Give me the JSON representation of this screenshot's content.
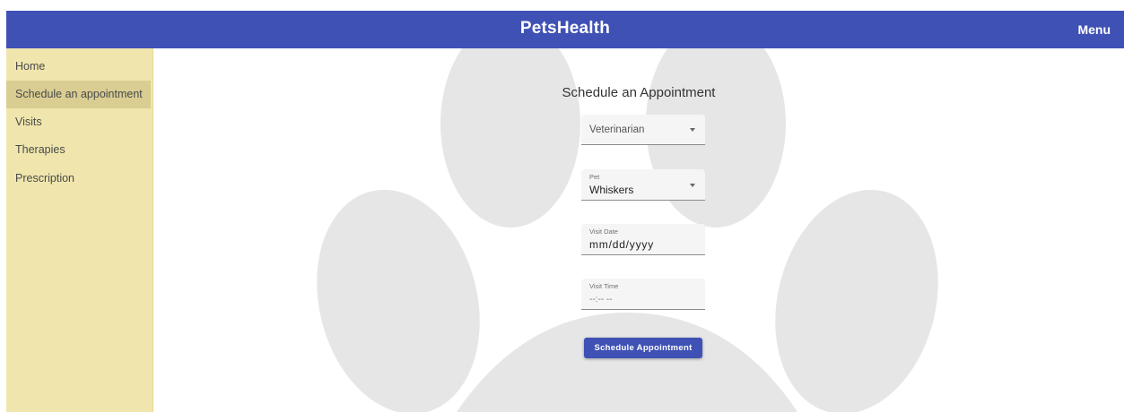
{
  "app": {
    "title": "PetsHealth",
    "menu_label": "Menu",
    "colors": {
      "header": "#3f51b5",
      "sidebar": "#f0e6ad",
      "sidebar_active": "#d9cd92",
      "paw": "#e6e6e6"
    }
  },
  "sidebar": {
    "items": [
      {
        "label": "Home"
      },
      {
        "label": "Schedule an appointment",
        "active": true
      },
      {
        "label": "Visits"
      },
      {
        "label": "Therapies"
      },
      {
        "label": "Prescription"
      }
    ]
  },
  "form": {
    "title": "Schedule an Appointment",
    "veterinarian": {
      "placeholder": "Veterinarian",
      "icon": "chevron-down-icon"
    },
    "pet": {
      "label": "Pet",
      "value": "Whiskers",
      "icon": "chevron-down-icon"
    },
    "visit_date": {
      "label": "Visit Date",
      "value": "mm/dd/yyyy"
    },
    "visit_time": {
      "label": "Visit Time",
      "value": "--:-- --"
    },
    "submit_label": "Schedule Appointment"
  },
  "background": {
    "icon": "paw-print-icon"
  }
}
